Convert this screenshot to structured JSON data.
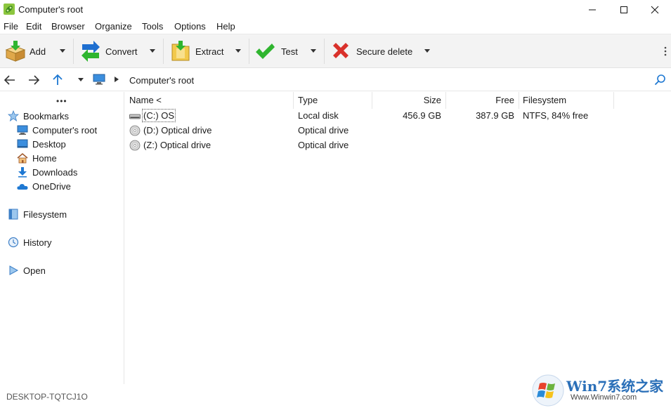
{
  "window": {
    "title": "Computer's root"
  },
  "menu": [
    "File",
    "Edit",
    "Browser",
    "Organize",
    "Tools",
    "Options",
    "Help"
  ],
  "toolbar": {
    "add": "Add",
    "convert": "Convert",
    "extract": "Extract",
    "test": "Test",
    "secure_delete": "Secure delete"
  },
  "address": {
    "path": "Computer's root"
  },
  "sidebar": {
    "bookmarks_label": "Bookmarks",
    "bookmarks": [
      "Computer's root",
      "Desktop",
      "Home",
      "Downloads",
      "OneDrive"
    ],
    "filesystem": "Filesystem",
    "history": "History",
    "open": "Open"
  },
  "columns": {
    "name": "Name <",
    "type": "Type",
    "size": "Size",
    "free": "Free",
    "filesystem": "Filesystem"
  },
  "rows": [
    {
      "name": "(C:) OS",
      "type": "Local disk",
      "size": "456.9 GB",
      "free": "387.9 GB",
      "filesystem": "NTFS, 84% free"
    },
    {
      "name": "(D:) Optical drive",
      "type": "Optical drive",
      "size": "",
      "free": "",
      "filesystem": ""
    },
    {
      "name": "(Z:) Optical drive",
      "type": "Optical drive",
      "size": "",
      "free": "",
      "filesystem": ""
    }
  ],
  "status": {
    "computer": "DESKTOP-TQTCJ1O"
  },
  "watermark": {
    "brand": "Win7系统之家",
    "url": "Www.Winwin7.com"
  },
  "colors": {
    "accent": "#1e78d2",
    "toolbar_bg": "#f3f3f3",
    "test_green": "#2fb52f",
    "delete_red": "#d9312b"
  }
}
